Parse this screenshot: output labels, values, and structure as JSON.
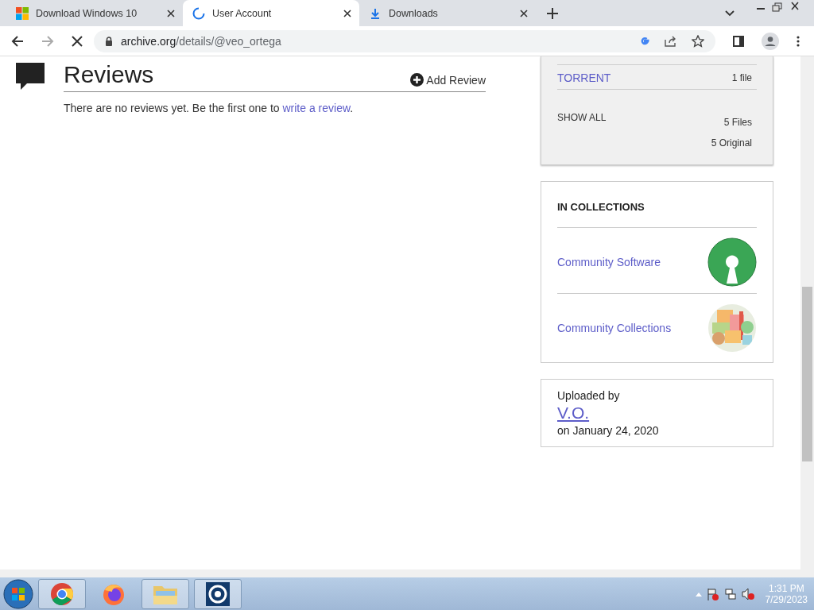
{
  "tabs": [
    {
      "title": "Download Windows 10",
      "kind": "windows",
      "selected": false
    },
    {
      "title": "User Account",
      "kind": "loading",
      "selected": true
    },
    {
      "title": "Downloads",
      "kind": "download",
      "selected": false
    }
  ],
  "address_bar": {
    "domain": "archive.org",
    "path": "/details/@veo_ortega"
  },
  "reviews": {
    "title": "Reviews",
    "add_button": "Add Review",
    "text": "There are no reviews yet. Be the first one to ",
    "link": "write a review",
    "end": "."
  },
  "downloads": {
    "rows": [
      {
        "label": "TORRENT",
        "count": "1 file"
      }
    ],
    "show_all": "SHOW ALL",
    "files": "5 Files",
    "original": "5 Original"
  },
  "collections": {
    "title": "IN COLLECTIONS",
    "items": [
      {
        "name": "Community Software",
        "kind": "keyhole"
      },
      {
        "name": "Community Collections",
        "kind": "mosaic"
      }
    ]
  },
  "uploader": {
    "label": "Uploaded by",
    "name": "V.O.",
    "date": "on January 24, 2020"
  },
  "taskbar": {
    "time": "1:31 PM",
    "date": "7/29/2023"
  }
}
